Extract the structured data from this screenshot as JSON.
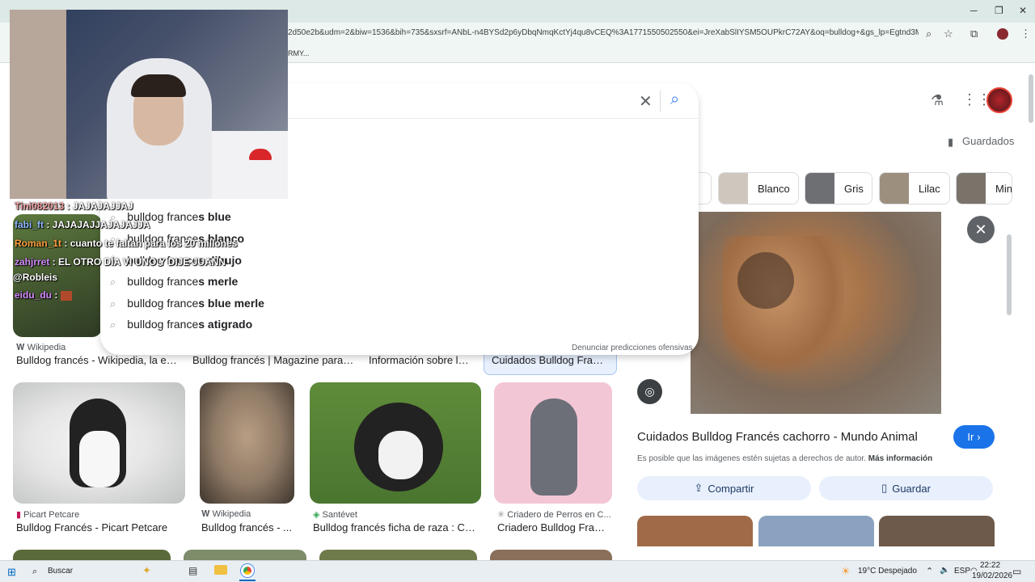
{
  "browser": {
    "url": "2d50e2b&udm=2&biw=1536&bih=735&sxsrf=ANbL-n4BYSd2p6yDbqNmqKctYj4qu8vCEQ%3A1771550502550&ei=JreXabSlIYSM5OUPkrC72AY&oq=bulldog+&gs_lp=Egtnd3Mtd2l6LWlt...",
    "bookmark_fragment": "RMY..."
  },
  "chat": [
    {
      "user": "Tini082013",
      "msg": ": JAJAJAJJAJ",
      "color": "#f0a0a0"
    },
    {
      "user": "fabi_ft",
      "msg": ": JAJAJAJJAJAJAJJA",
      "color": "#8fb8ff"
    },
    {
      "user": "Roman_1t",
      "msg": ": cuanto te faltan para los 20 millones",
      "color": "#ffa040"
    },
    {
      "user": "zahjrret",
      "msg": ": EL OTRO DÍA VI UNO Y DIJE JUANN",
      "color": "#d38aff"
    },
    {
      "user": "@Robleis",
      "msg": "",
      "color": "#ffffff"
    },
    {
      "user": "eidu_du",
      "msg": ":",
      "color": "#d38aff"
    }
  ],
  "suggestions": [
    {
      "base": "bulldog france",
      "bold": "s blue"
    },
    {
      "base": "bulldog france",
      "bold": "s blanco"
    },
    {
      "base": "bulldog france",
      "bold": "s dibujo"
    },
    {
      "base": "bulldog france",
      "bold": "s merle"
    },
    {
      "base": "bulldog france",
      "bold": "s blue merle"
    },
    {
      "base": "bulldog france",
      "bold": "s atigrado"
    }
  ],
  "report_link": "Denunciar predicciones ofensivas",
  "header": {
    "saved_label": "Guardados"
  },
  "chips": [
    {
      "label": "o"
    },
    {
      "label": "Blanco"
    },
    {
      "label": "Gris"
    },
    {
      "label": "Lilac"
    },
    {
      "label": "Min"
    }
  ],
  "results_row1": [
    {
      "source": "Wikipedia",
      "title": "Bulldog francés - Wikipedia, la en..."
    },
    {
      "source": "",
      "title": "Bulldog francés | Magazine para p..."
    },
    {
      "source": "",
      "title": "Información sobre la r..."
    },
    {
      "source": "",
      "title": "Cuidados Bulldog Franc..."
    }
  ],
  "results_row2": [
    {
      "source": "Picart Petcare",
      "title": "Bulldog Francés - Picart Petcare"
    },
    {
      "source": "Wikipedia",
      "title": "Bulldog francés - ..."
    },
    {
      "source": "Santévet",
      "title": "Bulldog francés ficha de raza : Cará..."
    },
    {
      "source": "Criadero de Perros en C...",
      "title": "Criadero Bulldog Franc..."
    }
  ],
  "panel": {
    "title": "Cuidados Bulldog Francés cachorro - Mundo Animal",
    "go_label": "Ir",
    "copyright": "Es posible que las imágenes estén sujetas a derechos de autor.",
    "more_info": "Más información",
    "share_label": "Compartir",
    "save_label": "Guardar"
  },
  "taskbar": {
    "search_label": "Buscar",
    "weather": "19°C  Despejado",
    "lang": "ESP",
    "time": "22:22",
    "date": "19/02/2026"
  }
}
